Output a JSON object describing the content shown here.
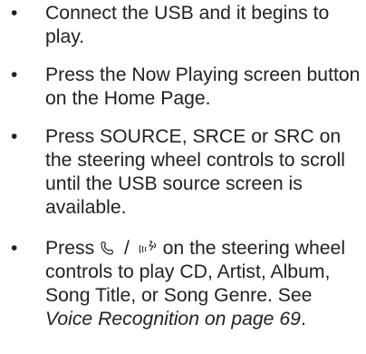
{
  "bullets": [
    {
      "text": "Connect the USB and it begins to play."
    },
    {
      "text": "Press the Now Playing screen button on the Home Page."
    },
    {
      "text": "Press SOURCE, SRCE or SRC on the steering wheel controls to scroll until the USB source screen is available."
    },
    {
      "prefix": "Press",
      "separator": "/",
      "suffix": "on the steering wheel controls to play CD, Artist, Album, Song Title, or Song Genre. See",
      "link_text": "Voice Recognition on page 69",
      "end": "."
    }
  ],
  "icons": {
    "push_to_talk": "phone-handset-icon",
    "voice": "voice-icon"
  }
}
